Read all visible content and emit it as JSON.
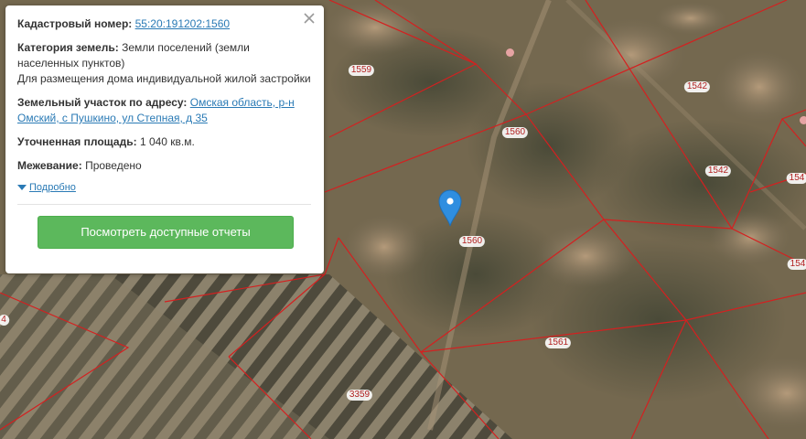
{
  "popup": {
    "cadastral_label": "Кадастровый номер:",
    "cadastral_number": "55:20:191202:1560",
    "category_label": "Категория земель:",
    "category_value": "Земли поселений (земли населенных пунктов)",
    "purpose": "Для размещения дома индивидуальной жилой застройки",
    "address_label": "Земельный участок по адресу:",
    "address_value": "Омская область, р-н Омский, с Пушкино, ул Степная, д 35",
    "area_label": "Уточненная площадь:",
    "area_value": "1 040 кв.м.",
    "survey_label": "Межевание:",
    "survey_value": "Проведено",
    "details_link": "Подробно",
    "reports_button": "Посмотреть доступные отчеты"
  },
  "map": {
    "boundary_color": "#d42020",
    "pin_color": "#2f8ee0",
    "plot_labels": [
      "1559",
      "1542",
      "1560",
      "1542",
      "1560",
      "1561",
      "3359",
      "154",
      "154",
      "4"
    ]
  }
}
